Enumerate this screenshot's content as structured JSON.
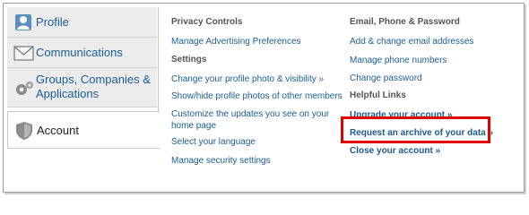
{
  "sidebar": {
    "items": [
      {
        "label": "Profile",
        "icon": "user-icon"
      },
      {
        "label": "Communications",
        "icon": "envelope-icon"
      },
      {
        "label": "Groups, Companies & Applications",
        "icon": "gears-icon"
      },
      {
        "label": "Account",
        "icon": "shield-icon",
        "active": true
      }
    ]
  },
  "privacy": {
    "heading": "Privacy Controls",
    "links": [
      "Manage Advertising Preferences"
    ]
  },
  "settings": {
    "heading": "Settings",
    "links": [
      "Change your profile photo & visibility »",
      "Show/hide profile photos of other members",
      "Customize the updates you see on your home page",
      "Select your language",
      "Manage security settings"
    ]
  },
  "email": {
    "heading": "Email, Phone & Password",
    "links": [
      "Add & change email addresses",
      "Manage phone numbers",
      "Change password"
    ]
  },
  "help": {
    "heading": "Helpful Links",
    "links": [
      "Upgrade your account »",
      "Request an archive of your data »",
      "Close your account »"
    ]
  },
  "colors": {
    "link": "#1a5d98",
    "highlight": "#e00000"
  }
}
